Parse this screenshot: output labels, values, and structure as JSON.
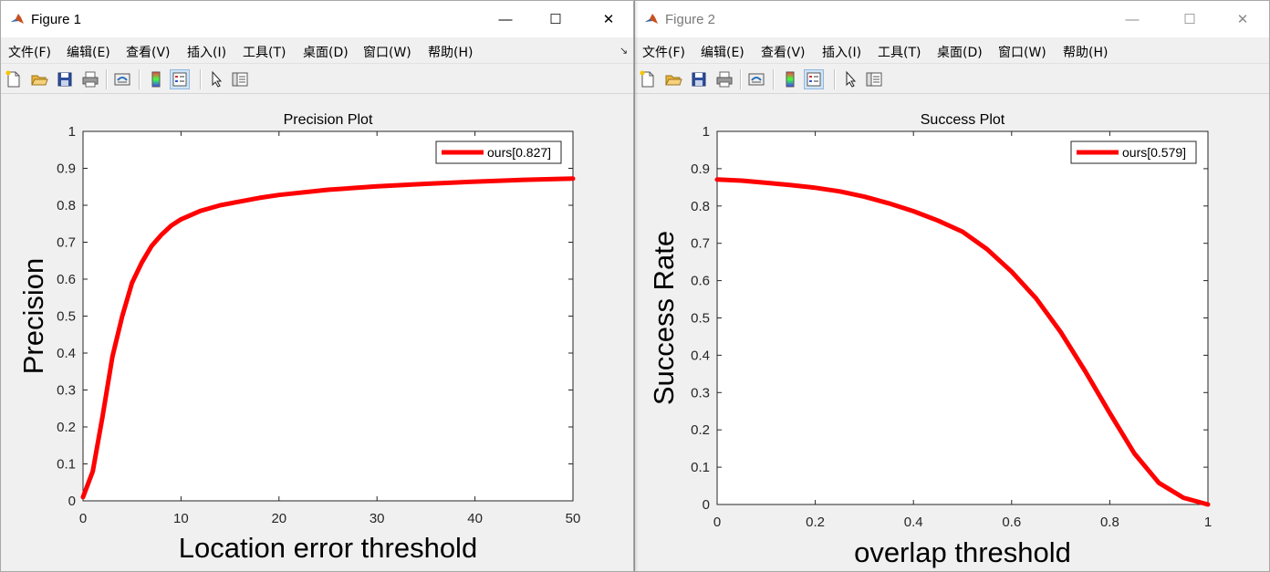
{
  "windows": [
    {
      "title": "Figure 1",
      "active": true,
      "menu": [
        "文件(F)",
        "编辑(E)",
        "查看(V)",
        "插入(I)",
        "工具(T)",
        "桌面(D)",
        "窗口(W)",
        "帮助(H)"
      ],
      "controls": {
        "minimize": "—",
        "maximize": "☐",
        "close": "✕"
      }
    },
    {
      "title": "Figure 2",
      "active": false,
      "menu": [
        "文件(F)",
        "编辑(E)",
        "查看(V)",
        "插入(I)",
        "工具(T)",
        "桌面(D)",
        "窗口(W)",
        "帮助(H)"
      ],
      "controls": {
        "minimize": "—",
        "maximize": "☐",
        "close": "✕"
      }
    }
  ],
  "toolbar_icons": [
    "new-figure-icon",
    "open-icon",
    "save-icon",
    "print-icon",
    "link-icon",
    "colorbar-icon",
    "legend-icon",
    "pointer-icon",
    "property-editor-icon"
  ],
  "chart_data": [
    {
      "type": "line",
      "title": "Precision Plot",
      "xlabel": "Location error threshold",
      "ylabel": "Precision",
      "xlim": [
        0,
        50
      ],
      "ylim": [
        0,
        1
      ],
      "xticks": [
        0,
        10,
        20,
        30,
        40,
        50
      ],
      "yticks": [
        0,
        0.1,
        0.2,
        0.3,
        0.4,
        0.5,
        0.6,
        0.7,
        0.8,
        0.9,
        1
      ],
      "legend_position": "top-right",
      "grid": false,
      "series": [
        {
          "name": "ours[0.827]",
          "color": "#ff0000",
          "x": [
            0,
            1,
            2,
            3,
            4,
            5,
            6,
            7,
            8,
            9,
            10,
            12,
            14,
            16,
            18,
            20,
            25,
            30,
            35,
            40,
            45,
            50
          ],
          "y": [
            0.01,
            0.08,
            0.23,
            0.39,
            0.5,
            0.59,
            0.645,
            0.69,
            0.72,
            0.745,
            0.762,
            0.785,
            0.8,
            0.81,
            0.82,
            0.828,
            0.842,
            0.851,
            0.858,
            0.864,
            0.869,
            0.872
          ]
        }
      ]
    },
    {
      "type": "line",
      "title": "Success Plot",
      "xlabel": "overlap threshold",
      "ylabel": "Success Rate",
      "xlim": [
        0,
        1
      ],
      "ylim": [
        0,
        1
      ],
      "xticks": [
        0,
        0.2,
        0.4,
        0.6,
        0.8,
        1
      ],
      "yticks": [
        0,
        0.1,
        0.2,
        0.3,
        0.4,
        0.5,
        0.6,
        0.7,
        0.8,
        0.9,
        1
      ],
      "legend_position": "top-right",
      "grid": false,
      "series": [
        {
          "name": "ours[0.579]",
          "color": "#ff0000",
          "x": [
            0,
            0.05,
            0.1,
            0.15,
            0.2,
            0.25,
            0.3,
            0.35,
            0.4,
            0.45,
            0.5,
            0.55,
            0.6,
            0.65,
            0.7,
            0.75,
            0.8,
            0.85,
            0.9,
            0.95,
            1
          ],
          "y": [
            0.871,
            0.868,
            0.862,
            0.856,
            0.849,
            0.839,
            0.825,
            0.807,
            0.786,
            0.761,
            0.731,
            0.684,
            0.624,
            0.552,
            0.462,
            0.357,
            0.245,
            0.137,
            0.058,
            0.018,
            0.0
          ]
        }
      ]
    }
  ]
}
